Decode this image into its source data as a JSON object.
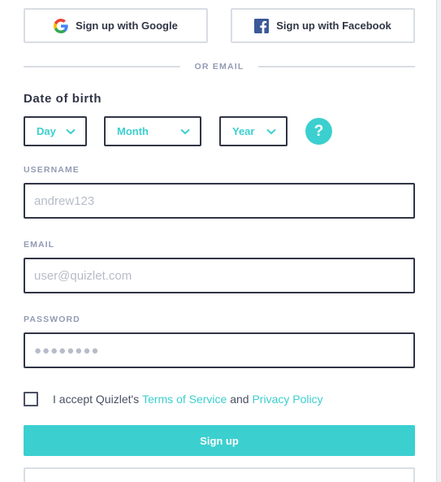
{
  "social": {
    "google_label": "Sign up with Google",
    "facebook_label": "Sign up with Facebook"
  },
  "divider": {
    "label": "OR EMAIL"
  },
  "dob": {
    "label": "Date of birth",
    "day": "Day",
    "month": "Month",
    "year": "Year",
    "help": "?"
  },
  "username": {
    "label": "USERNAME",
    "placeholder": "andrew123"
  },
  "email": {
    "label": "EMAIL",
    "placeholder": "user@quizlet.com"
  },
  "password": {
    "label": "PASSWORD",
    "placeholder": "●●●●●●●●"
  },
  "terms": {
    "prefix": "I accept Quizlet's ",
    "tos": "Terms of Service",
    "and": " and ",
    "privacy": "Privacy Policy"
  },
  "signup": {
    "label": "Sign up"
  },
  "colors": {
    "accent": "#3ccfcf",
    "text": "#303545",
    "muted": "#939bb4",
    "border": "#d9dde4",
    "facebook": "#3b5998"
  },
  "icons": {
    "google": "google-logo-icon",
    "facebook": "facebook-logo-icon",
    "chevron": "chevron-down-icon",
    "help": "question-mark-icon"
  }
}
